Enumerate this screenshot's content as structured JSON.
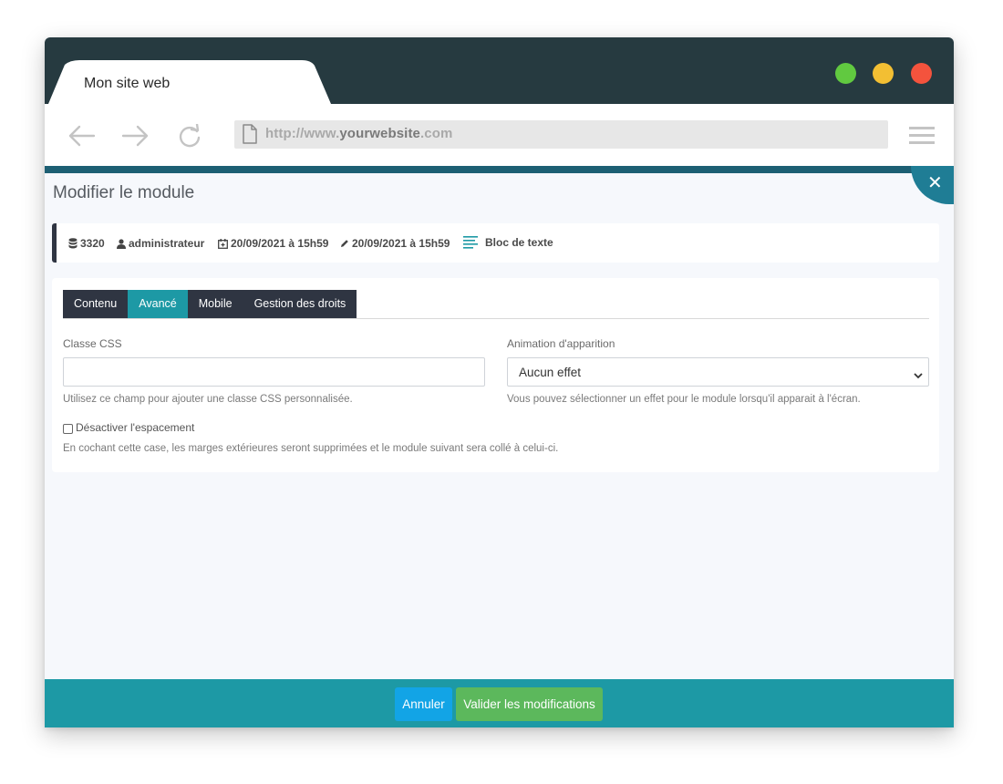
{
  "browser": {
    "tab_title": "Mon site web",
    "url_prefix": "http://www.",
    "url_domain": "yourwebsite",
    "url_suffix": ".com",
    "window_colors": {
      "close": "#f4533d",
      "minimize": "#f3bf33",
      "maximize": "#61c940"
    }
  },
  "modal": {
    "title": "Modifier le module",
    "close_icon": "close-icon"
  },
  "meta": {
    "id": "3320",
    "author": "administrateur",
    "created": "20/09/2021 à 15h59",
    "modified": "20/09/2021 à 15h59",
    "type": "Bloc de texte"
  },
  "tabs": [
    {
      "label": "Contenu",
      "active": false
    },
    {
      "label": "Avancé",
      "active": true
    },
    {
      "label": "Mobile",
      "active": false
    },
    {
      "label": "Gestion des droits",
      "active": false
    }
  ],
  "form": {
    "css_class_label": "Classe CSS",
    "css_class_value": "",
    "css_class_help": "Utilisez ce champ pour ajouter une classe CSS personnalisée.",
    "animation_label": "Animation d'apparition",
    "animation_value": "Aucun effet",
    "animation_help": "Vous pouvez sélectionner un effet pour le module lorsqu'il apparait à l'écran.",
    "spacing_label": "Désactiver l'espacement",
    "spacing_checked": false,
    "spacing_help": "En cochant cette case, les marges extérieures seront supprimées et le module suivant sera collé à celui-ci."
  },
  "footer": {
    "cancel_label": "Annuler",
    "save_label": "Valider les modifications"
  },
  "colors": {
    "accent": "#1d99a5",
    "dark": "#2f3542",
    "save": "#5cb85c",
    "cancel": "#12a4e6"
  }
}
